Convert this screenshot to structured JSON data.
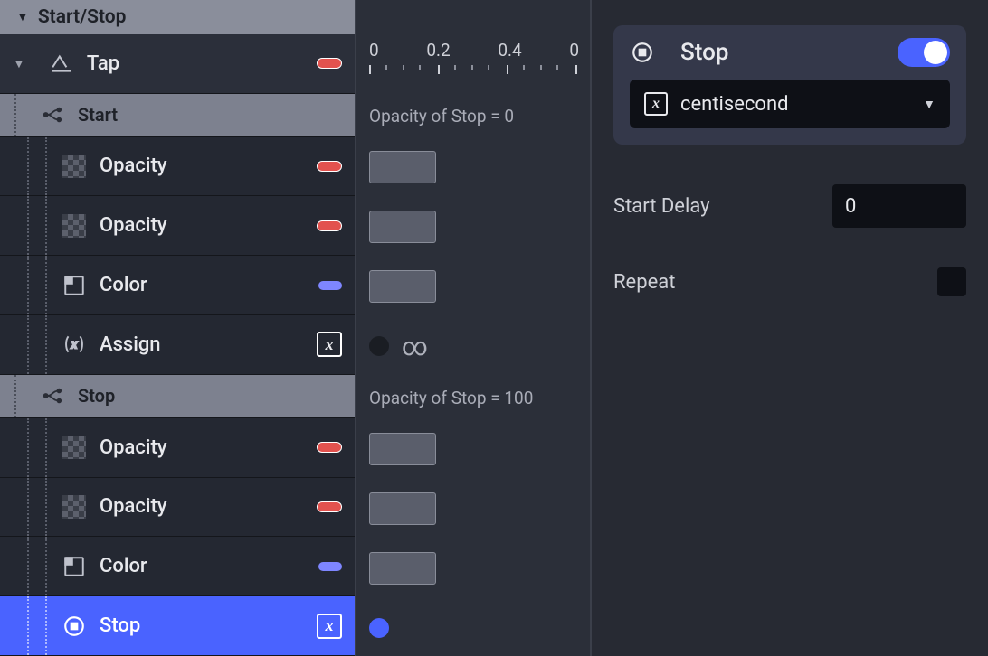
{
  "panel_title": "Start/Stop",
  "tree": {
    "tap": {
      "label": "Tap"
    },
    "branches": [
      {
        "label": "Start"
      },
      {
        "label": "Stop"
      }
    ],
    "start_children": [
      {
        "label": "Opacity",
        "kind": "opacity"
      },
      {
        "label": "Opacity",
        "kind": "opacity"
      },
      {
        "label": "Color",
        "kind": "color"
      },
      {
        "label": "Assign",
        "kind": "assign"
      }
    ],
    "stop_children": [
      {
        "label": "Opacity",
        "kind": "opacity"
      },
      {
        "label": "Opacity",
        "kind": "opacity"
      },
      {
        "label": "Color",
        "kind": "color"
      },
      {
        "label": "Stop",
        "kind": "stop",
        "selected": true
      }
    ]
  },
  "timeline": {
    "ticks": [
      "0",
      "0.2",
      "0.4",
      "0"
    ],
    "start_header": "Opacity of Stop = 0",
    "stop_header": "Opacity of Stop = 100"
  },
  "inspector": {
    "title": "Stop",
    "toggle_on": true,
    "dropdown_value": "centisecond",
    "start_delay_label": "Start Delay",
    "start_delay_value": "0",
    "repeat_label": "Repeat",
    "repeat_checked": false
  }
}
